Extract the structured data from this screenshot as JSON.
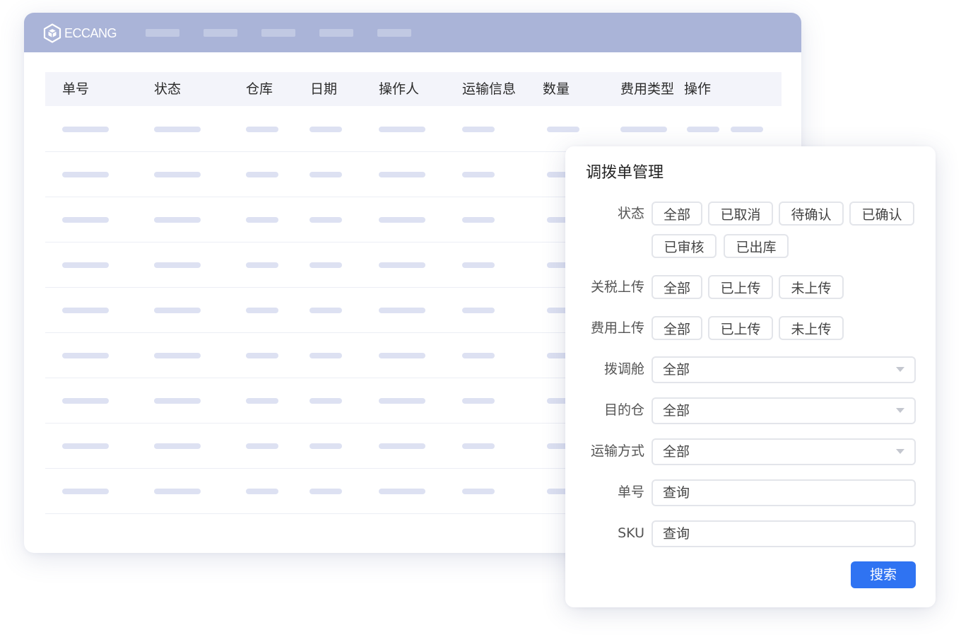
{
  "app": {
    "brand": "ECCANG"
  },
  "table": {
    "columns": [
      "单号",
      "状态",
      "仓库",
      "日期",
      "操作人",
      "运输信息",
      "数量",
      "费用类型",
      "操作"
    ]
  },
  "panel": {
    "title": "调拨单管理",
    "status": {
      "label": "状态",
      "options": [
        "全部",
        "已取消",
        "待确认",
        "已确认",
        "已审核",
        "已出库"
      ]
    },
    "tariff_upload": {
      "label": "关税上传",
      "options": [
        "全部",
        "已上传",
        "未上传"
      ]
    },
    "fee_upload": {
      "label": "费用上传",
      "options": [
        "全部",
        "已上传",
        "未上传"
      ]
    },
    "transfer_bay": {
      "label": "拨调舱",
      "value": "全部"
    },
    "destination": {
      "label": "目的仓",
      "value": "全部"
    },
    "shipping_method": {
      "label": "运输方式",
      "value": "全部"
    },
    "order_no": {
      "label": "单号",
      "placeholder": "查询"
    },
    "sku": {
      "label": "SKU",
      "placeholder": "查询"
    },
    "search_label": "搜索"
  },
  "colors": {
    "topbar": "#aab4d8",
    "accent": "#2f73f2",
    "placeholder_bar": "#dde1f2"
  }
}
